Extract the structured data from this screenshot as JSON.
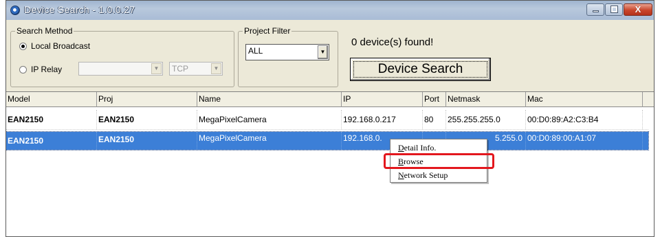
{
  "window": {
    "title": "Device Search - 1.0.0.27",
    "controls": {
      "minimize": "minimize",
      "maximize": "maximize",
      "close": "X"
    }
  },
  "search_method": {
    "legend": "Search Method",
    "local_broadcast": {
      "label": "Local Broadcast",
      "checked": true
    },
    "ip_relay": {
      "label": "IP Relay",
      "checked": false,
      "ip_value": "",
      "protocol": "TCP"
    }
  },
  "project_filter": {
    "legend": "Project Filter",
    "selected": "ALL"
  },
  "status": {
    "found_text": "0 device(s) found!"
  },
  "actions": {
    "device_search": "Device Search"
  },
  "table": {
    "columns": [
      "Model",
      "Proj",
      "Name",
      "IP",
      "Port",
      "Netmask",
      "Mac"
    ],
    "rows": [
      {
        "model": "EAN2150",
        "proj": "EAN2150",
        "name": "MegaPixelCamera",
        "ip": "192.168.0.217",
        "port": "80",
        "netmask": "255.255.255.0",
        "mac": "00:D0:89:A2:C3:B4"
      },
      {
        "model": "EAN2150",
        "proj": "EAN2150",
        "name": "MegaPixelCamera",
        "ip": "192.168.0.",
        "port": "",
        "netmask": "5.255.0",
        "mac": "00:D0:89:00:A1:07",
        "selected": true
      }
    ]
  },
  "context_menu": {
    "items": [
      {
        "mnemonic": "D",
        "rest": "etail Info."
      },
      {
        "mnemonic": "B",
        "rest": "rowse"
      },
      {
        "mnemonic": "N",
        "rest": "etwork Setup"
      }
    ]
  },
  "colors": {
    "selection": "#3c7fd7",
    "highlight_box": "#e3171d",
    "window_bg": "#ece9d8"
  },
  "icons": [
    "app-icon",
    "radio-icon",
    "chevron-down-icon",
    "minimize-icon",
    "maximize-icon",
    "close-icon"
  ]
}
